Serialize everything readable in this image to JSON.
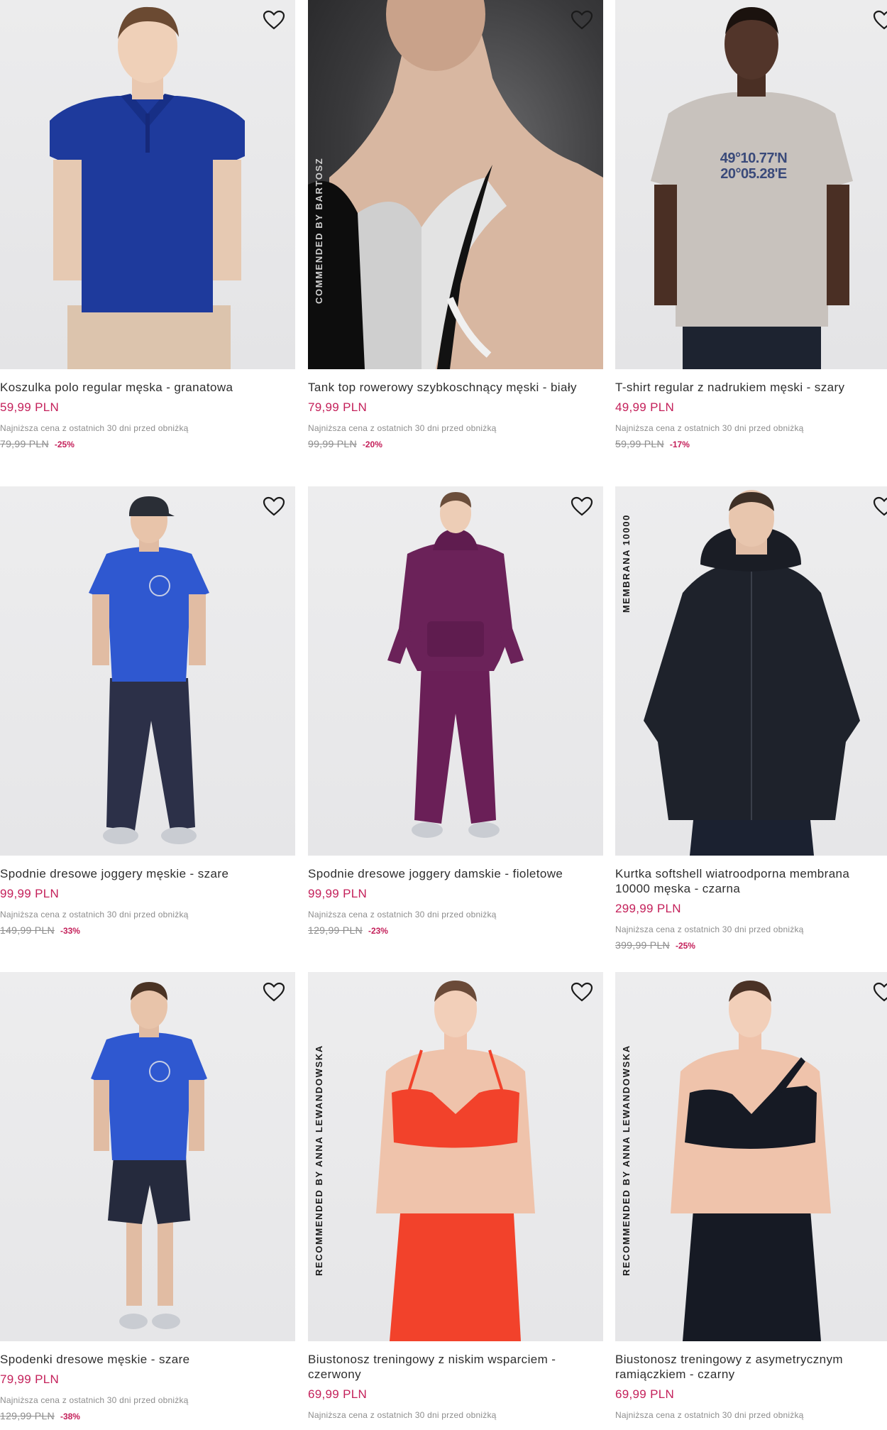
{
  "products": [
    {
      "name": "Koszulka polo regular męska - granatowa",
      "price": "59,99 PLN",
      "lowest_label": "Najniższa cena z ostatnich 30 dni przed obniżką",
      "old_price": "79,99 PLN",
      "discount": "-25%",
      "badge": ""
    },
    {
      "name": "Tank top rowerowy szybkoschnący męski - biały",
      "price": "79,99 PLN",
      "lowest_label": "Najniższa cena z ostatnich 30 dni przed obniżką",
      "old_price": "99,99 PLN",
      "discount": "-20%",
      "badge": "COMMENDED BY BARTOSZ"
    },
    {
      "name": "T-shirt regular z nadrukiem męski - szary",
      "price": "49,99 PLN",
      "lowest_label": "Najniższa cena z ostatnich 30 dni przed obniżką",
      "old_price": "59,99 PLN",
      "discount": "-17%",
      "badge": "",
      "print_line1": "49°10.77'N",
      "print_line2": "20°05.28'E"
    },
    {
      "name": "Spodnie dresowe joggery męskie - szare",
      "price": "99,99 PLN",
      "lowest_label": "Najniższa cena z ostatnich 30 dni przed obniżką",
      "old_price": "149,99 PLN",
      "discount": "-33%",
      "badge": ""
    },
    {
      "name": "Spodnie dresowe joggery damskie - fioletowe",
      "price": "99,99 PLN",
      "lowest_label": "Najniższa cena z ostatnich 30 dni przed obniżką",
      "old_price": "129,99 PLN",
      "discount": "-23%",
      "badge": ""
    },
    {
      "name": "Kurtka softshell wiatroodporna membrana 10000 męska - czarna",
      "price": "299,99 PLN",
      "lowest_label": "Najniższa cena z ostatnich 30 dni przed obniżką",
      "old_price": "399,99 PLN",
      "discount": "-25%",
      "badge": "MEMBRANA 10000"
    },
    {
      "name": "Spodenki dresowe męskie - szare",
      "price": "79,99 PLN",
      "lowest_label": "Najniższa cena z ostatnich 30 dni przed obniżką",
      "old_price": "129,99 PLN",
      "discount": "-38%",
      "badge": ""
    },
    {
      "name": "Biustonosz treningowy z niskim wsparciem - czerwony",
      "price": "69,99 PLN",
      "lowest_label": "Najniższa cena z ostatnich 30 dni przed obniżką",
      "old_price": "",
      "discount": "",
      "badge": "RECOMMENDED BY ANNA LEWANDOWSKA"
    },
    {
      "name": "Biustonosz treningowy z asymetrycznym ramiączkiem - czarny",
      "price": "69,99 PLN",
      "lowest_label": "Najniższa cena z ostatnich 30 dni przed obniżką",
      "old_price": "",
      "discount": "",
      "badge": "RECOMMENDED BY ANNA LEWANDOWSKA"
    }
  ],
  "colors": {
    "price": "#c4205a",
    "muted": "#8d8d8d",
    "text": "#2e2e2e"
  },
  "icons": {
    "wishlist": "heart-outline-icon"
  }
}
